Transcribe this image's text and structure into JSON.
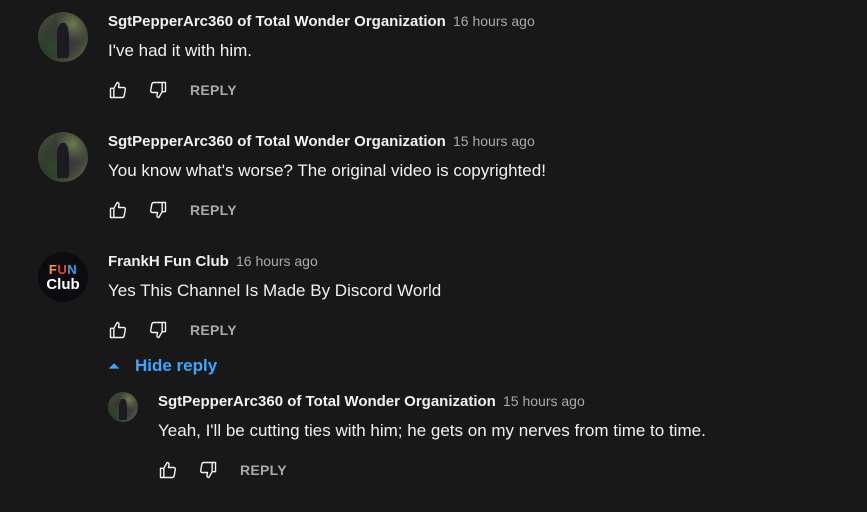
{
  "comments": [
    {
      "author": "SgtPepperArc360 of Total Wonder Organization",
      "time": "16 hours ago",
      "text": "I've had it with him.",
      "reply_label": "REPLY"
    },
    {
      "author": "SgtPepperArc360 of Total Wonder Organization",
      "time": "15 hours ago",
      "text": "You know what's worse? The original video is copyrighted!",
      "reply_label": "REPLY"
    },
    {
      "author": "FrankH Fun Club",
      "time": "16 hours ago",
      "text": "Yes This Channel Is Made By Discord World",
      "reply_label": "REPLY",
      "avatar_text": {
        "f": "F",
        "u": "U",
        "n": "N",
        "club": "Club"
      }
    }
  ],
  "replies_toggle": {
    "label": "Hide reply"
  },
  "reply": {
    "author": "SgtPepperArc360 of Total Wonder Organization",
    "time": "15 hours ago",
    "text": "Yeah, I'll be cutting ties with him; he gets on my nerves from time to time.",
    "reply_label": "REPLY"
  },
  "colors": {
    "background": "#181818",
    "text": "#f1f1f1",
    "secondary_text": "#aaaaaa",
    "link_blue": "#3ea6ff"
  },
  "icons": [
    "thumbs-up-icon",
    "thumbs-down-icon",
    "chevron-up-icon"
  ]
}
